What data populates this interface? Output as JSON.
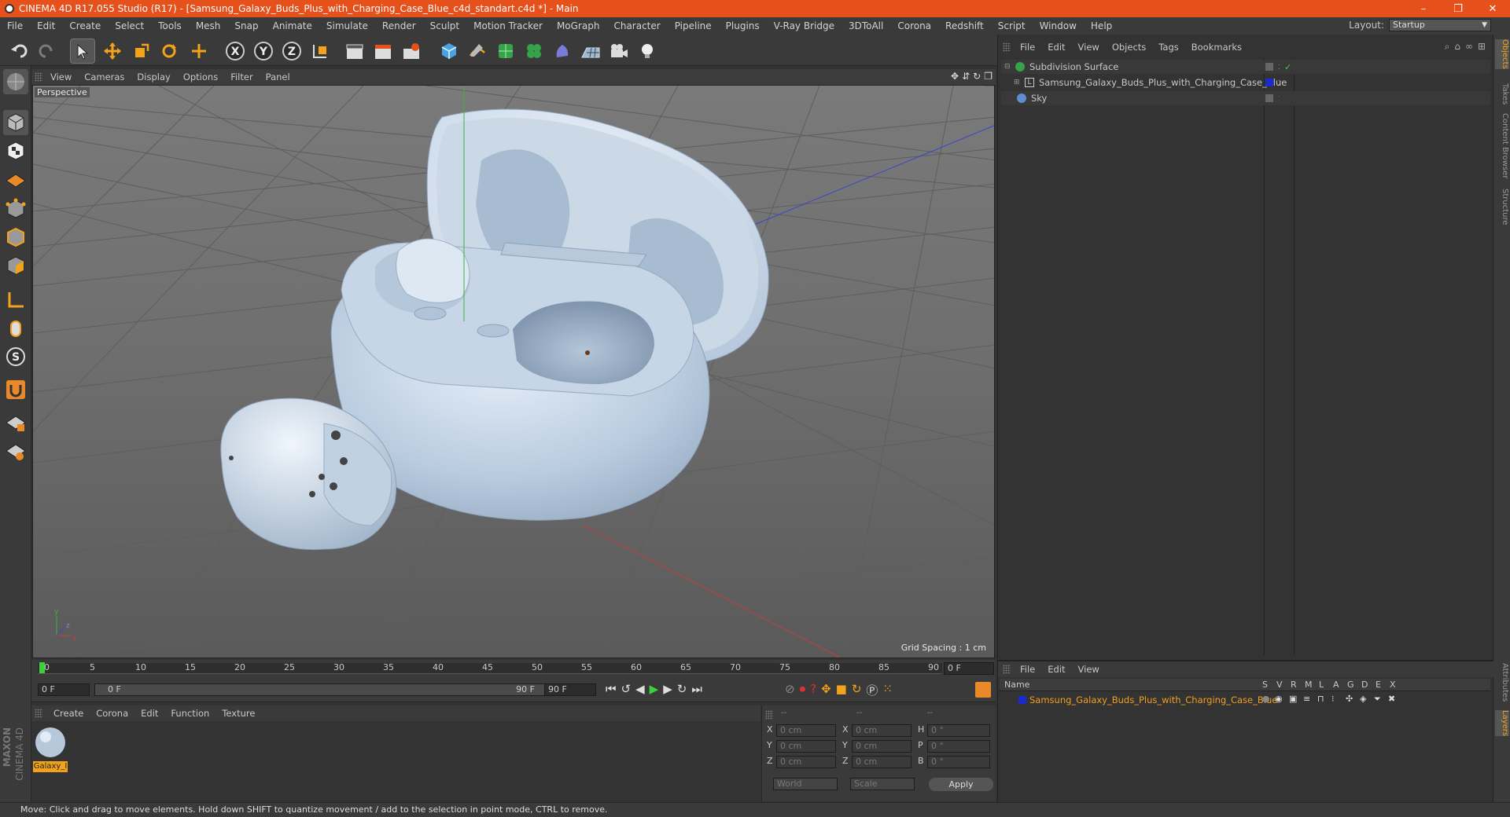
{
  "title": "CINEMA 4D R17.055 Studio (R17) - [Samsung_Galaxy_Buds_Plus_with_Charging_Case_Blue_c4d_standart.c4d *] - Main",
  "window_controls": {
    "minimize": "–",
    "restore": "❐",
    "close": "✕"
  },
  "menu": [
    "File",
    "Edit",
    "Create",
    "Select",
    "Tools",
    "Mesh",
    "Snap",
    "Animate",
    "Simulate",
    "Render",
    "Sculpt",
    "Motion Tracker",
    "MoGraph",
    "Character",
    "Pipeline",
    "Plugins",
    "V-Ray Bridge",
    "3DToAll",
    "Corona",
    "Redshift",
    "Script",
    "Window",
    "Help"
  ],
  "layout": {
    "label": "Layout:",
    "value": "Startup"
  },
  "viewport": {
    "menu": [
      "View",
      "Cameras",
      "Display",
      "Options",
      "Filter",
      "Panel"
    ],
    "label": "Perspective",
    "grid_spacing": "Grid Spacing : 1 cm"
  },
  "timeline": {
    "ticks": [
      "0",
      "5",
      "10",
      "15",
      "20",
      "25",
      "30",
      "35",
      "40",
      "45",
      "50",
      "55",
      "60",
      "65",
      "70",
      "75",
      "80",
      "85",
      "90"
    ],
    "current_frame": "0 F",
    "start": "0 F",
    "range_start": "0 F",
    "range_end": "90 F",
    "end": "90 F"
  },
  "material_panel": {
    "menu": [
      "Create",
      "Corona",
      "Edit",
      "Function",
      "Texture"
    ],
    "material_name": "Galaxy_I"
  },
  "coords": {
    "headers": [
      "--",
      "--",
      "--"
    ],
    "rows": [
      {
        "a": "X",
        "av": "0 cm",
        "b": "X",
        "bv": "0 cm",
        "c": "H",
        "cv": "0 °"
      },
      {
        "a": "Y",
        "av": "0 cm",
        "b": "Y",
        "bv": "0 cm",
        "c": "P",
        "cv": "0 °"
      },
      {
        "a": "Z",
        "av": "0 cm",
        "b": "Z",
        "bv": "0 cm",
        "c": "B",
        "cv": "0 °"
      }
    ],
    "world": "World",
    "scale": "Scale",
    "apply": "Apply"
  },
  "object_manager": {
    "menu": [
      "File",
      "Edit",
      "View",
      "Objects",
      "Tags",
      "Bookmarks"
    ],
    "objects": [
      {
        "name": "Subdivision Surface",
        "color": "#d8d8d8"
      },
      {
        "name": "Samsung_Galaxy_Buds_Plus_with_Charging_Case_Blue",
        "color": "#d8d8d8"
      },
      {
        "name": "Sky",
        "color": "#d8d8d8"
      }
    ]
  },
  "side_tabs": [
    "Objects",
    "Takes",
    "Content Browser",
    "Structure",
    "Attributes",
    "Layers"
  ],
  "layer_manager": {
    "menu": [
      "File",
      "Edit",
      "View"
    ],
    "name_header": "Name",
    "cols": [
      "S",
      "V",
      "R",
      "M",
      "L",
      "A",
      "G",
      "D",
      "E",
      "X"
    ],
    "layer_name": "Samsung_Galaxy_Buds_Plus_with_Charging_Case_Blue"
  },
  "logo": {
    "line1": "MAXON",
    "line2": "CINEMA 4D"
  },
  "status": "Move: Click and drag to move elements. Hold down SHIFT to quantize movement / add to the selection in point mode, CTRL to remove.",
  "colors": {
    "accent": "#e6501b",
    "axis_x": "#c83c3c",
    "axis_y": "#3cb43c",
    "axis_z": "#3c46c8",
    "layer_blue": "#1a2ad0",
    "selected_text": "#f0a020"
  }
}
